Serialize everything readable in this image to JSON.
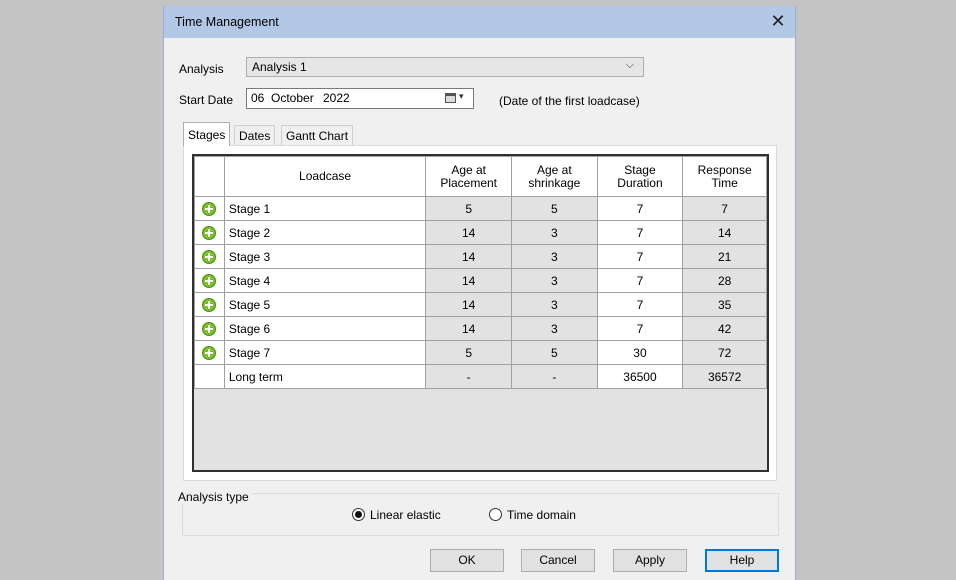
{
  "window": {
    "title": "Time Management",
    "close_glyph": "✕"
  },
  "analysis": {
    "label": "Analysis",
    "value": "Analysis 1",
    "arrow": "⌵"
  },
  "start_date": {
    "label": "Start Date",
    "day": "06",
    "month": "October",
    "year": "2022",
    "note": "(Date of the first loadcase)",
    "dropdown_arrow": "▾"
  },
  "tabs": [
    "Stages",
    "Dates",
    "Gantt Chart"
  ],
  "table": {
    "headers": {
      "loadcase": "Loadcase",
      "age_placement": [
        "Age at",
        "Placement"
      ],
      "age_shrinkage": [
        "Age at",
        "shrinkage"
      ],
      "stage_duration": [
        "Stage",
        "Duration"
      ],
      "response_time": [
        "Response",
        "Time"
      ]
    },
    "rows": [
      {
        "name": "Stage 1",
        "placement": "5",
        "shrinkage": "5",
        "duration": "7",
        "response": "7"
      },
      {
        "name": "Stage 2",
        "placement": "14",
        "shrinkage": "3",
        "duration": "7",
        "response": "14"
      },
      {
        "name": "Stage 3",
        "placement": "14",
        "shrinkage": "3",
        "duration": "7",
        "response": "21"
      },
      {
        "name": "Stage 4",
        "placement": "14",
        "shrinkage": "3",
        "duration": "7",
        "response": "28"
      },
      {
        "name": "Stage 5",
        "placement": "14",
        "shrinkage": "3",
        "duration": "7",
        "response": "35"
      },
      {
        "name": "Stage 6",
        "placement": "14",
        "shrinkage": "3",
        "duration": "7",
        "response": "42"
      },
      {
        "name": "Stage 7",
        "placement": "5",
        "shrinkage": "5",
        "duration": "30",
        "response": "72"
      },
      {
        "name": "Long term",
        "placement": "-",
        "shrinkage": "-",
        "duration": "36500",
        "response": "36572"
      }
    ]
  },
  "analysis_type": {
    "legend": "Analysis type",
    "options": [
      {
        "label": "Linear elastic",
        "selected": true
      },
      {
        "label": "Time domain",
        "selected": false
      }
    ]
  },
  "buttons": {
    "ok": "OK",
    "cancel": "Cancel",
    "apply": "Apply",
    "help": "Help"
  },
  "colors": {
    "titlebar": "#b3c7e6",
    "add_icon": "#7bbf2a",
    "default_button_border": "#0078d7"
  }
}
